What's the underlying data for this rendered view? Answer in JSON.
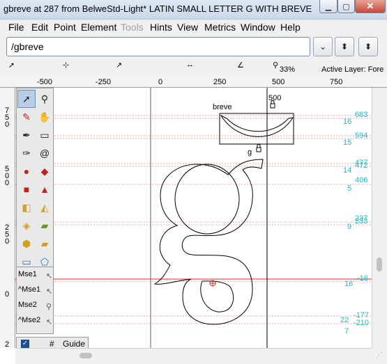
{
  "window": {
    "title": "gbreve at 287 from BelweStd-Light* LATIN SMALL LETTER G WITH BREVE",
    "min_icon": "minimize-icon",
    "max_icon": "maximize-icon",
    "close_icon": "close-icon"
  },
  "menu": {
    "items": [
      {
        "label": "File",
        "enabled": true
      },
      {
        "label": "Edit",
        "enabled": true
      },
      {
        "label": "Point",
        "enabled": true
      },
      {
        "label": "Element",
        "enabled": true
      },
      {
        "label": "Tools",
        "enabled": false
      },
      {
        "label": "Hints",
        "enabled": true
      },
      {
        "label": "View",
        "enabled": true
      },
      {
        "label": "Metrics",
        "enabled": true
      },
      {
        "label": "Window",
        "enabled": true
      },
      {
        "label": "Help",
        "enabled": true
      }
    ]
  },
  "glyph_field": {
    "value": "/gbreve"
  },
  "toolbar": {
    "zoom": "33%",
    "active_layer": "Active Layer: Fore"
  },
  "ruler_top": {
    "labels": [
      "-500",
      "-250",
      "0",
      "250",
      "500",
      "750"
    ]
  },
  "ruler_left": {
    "labels": [
      "750",
      "500",
      "250",
      "0",
      "2"
    ]
  },
  "canvas": {
    "width_marker_label": "500",
    "breve_label": "breve",
    "g_label": "g",
    "right_values": [
      "683",
      "16",
      "594",
      "15",
      "477",
      "472",
      "14",
      "406",
      "5",
      "237",
      "233",
      "9",
      "-16",
      "16",
      "-177",
      "22",
      "-210",
      "7"
    ],
    "accent_color": "#1ab8c4",
    "guide_color": "#e08080"
  },
  "palette": {
    "tools": [
      "pointer-tool",
      "magnify-tool",
      "freehand-tool",
      "scroll-tool",
      "pen-tool",
      "ruler-tool",
      "knife-tool",
      "spiro-tool",
      "curve-point-tool",
      "corner-point-tool",
      "tangent-point-tool",
      "hvcurve-tool",
      "scale-tool",
      "flip-tool",
      "rotate-tool",
      "skew-tool",
      "3d-rotate-tool",
      "perspective-tool",
      "rectangle-tool",
      "polygon-tool"
    ],
    "mouse_labels": [
      "Mse1",
      "^Mse1",
      "Mse2",
      "^Mse2"
    ]
  },
  "layers": {
    "checked": true,
    "hash": "#",
    "name": "Guide"
  }
}
